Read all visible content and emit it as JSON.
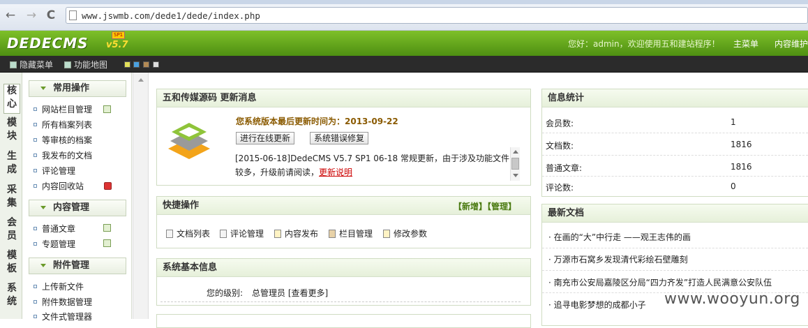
{
  "browser": {
    "url": "www.jswmb.com/dede1/dede/index.php",
    "back": "←",
    "forward": "→",
    "reload": "C"
  },
  "header": {
    "logo": "DEDECMS",
    "version": "v5.7",
    "badge": "SP1",
    "welcome": "您好：admin，欢迎使用五和建站程序！",
    "main_menu": "主菜单",
    "content_maint": "内容维护"
  },
  "toolbar": {
    "hide_menu": "隐藏菜单",
    "site_map": "功能地图",
    "swatches": [
      "#e2e05a",
      "#4aa0e0",
      "#b28a55",
      "#dddddd"
    ]
  },
  "left_tabs": [
    "核心",
    "模块",
    "生成",
    "采集",
    "会员",
    "模板",
    "系统"
  ],
  "left_menu": {
    "sections": [
      {
        "title": "常用操作",
        "items": [
          "网站栏目管理",
          "所有档案列表",
          "等审核的档案",
          "我发布的文档",
          "评论管理",
          "内容回收站"
        ]
      },
      {
        "title": "内容管理",
        "items": [
          "普通文章",
          "专题管理"
        ]
      },
      {
        "title": "附件管理",
        "items": [
          "上传新文件",
          "附件数据管理",
          "文件式管理器"
        ]
      }
    ]
  },
  "update_panel": {
    "title": "五和传媒源码 更新消息",
    "last_update": "您系统版本最后更新时间为：2013-09-22",
    "btn_online": "进行在线更新",
    "btn_fix": "系统错误修复",
    "news_text": "[2015-06-18]DedeCMS V5.7 SP1 06-18 常规更新，由于涉及功能文件较多，升级前请阅读，",
    "news_link": "更新说明"
  },
  "quick_panel": {
    "title": "快捷操作",
    "links": "【新增】【管理】",
    "items": [
      "文档列表",
      "评论管理",
      "内容发布",
      "栏目管理",
      "修改参数"
    ]
  },
  "sysinfo_panel": {
    "title": "系统基本信息",
    "level_label": "您的级别:",
    "level_value": "总管理员 [查看更多]"
  },
  "stats_panel": {
    "title": "信息统计",
    "rows": [
      {
        "label": "会员数:",
        "value": "1"
      },
      {
        "label": "文档数:",
        "value": "1816"
      },
      {
        "label": "普通文章:",
        "value": "1816"
      },
      {
        "label": "评论数:",
        "value": "0"
      }
    ]
  },
  "latest_panel": {
    "title": "最新文档",
    "items": [
      "· 在画的“大”中行走 ——观王志伟的画",
      "· 万源市石窝乡发现清代彩绘石壁雕刻",
      "· 南充市公安局嘉陵区分局“四力齐发”打造人民满意公安队伍",
      "· 追寻电影梦想的成都小子"
    ]
  },
  "watermark": "www.wooyun.org"
}
